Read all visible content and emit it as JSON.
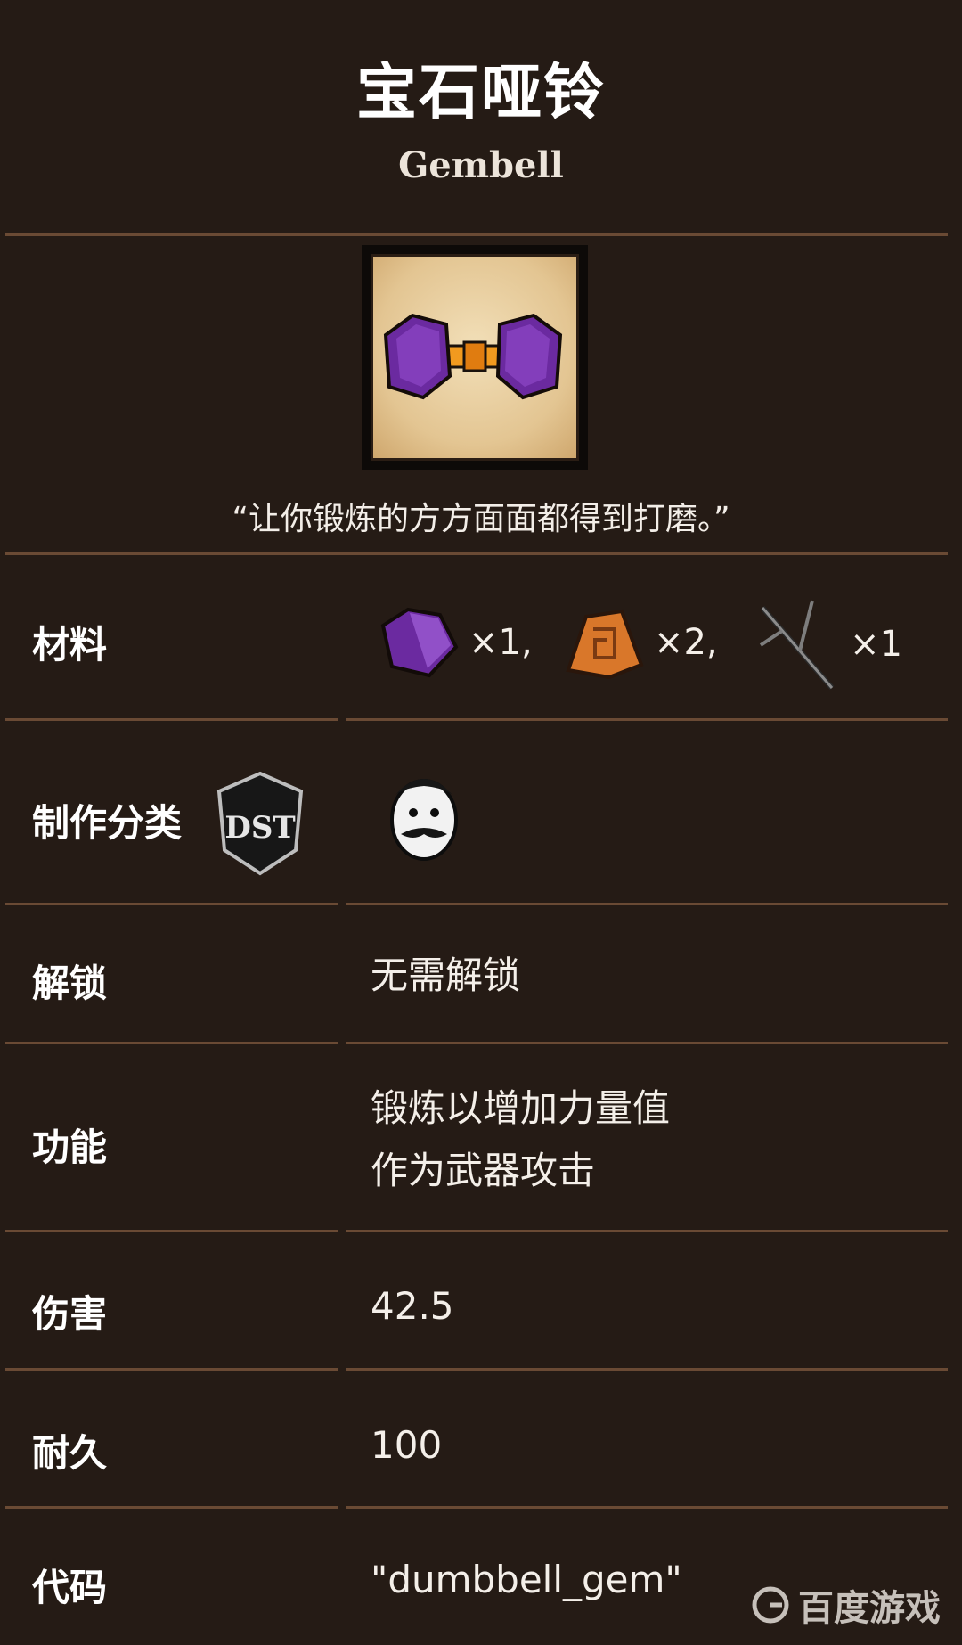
{
  "item": {
    "title_cn": "宝石哑铃",
    "title_en": "Gembell",
    "quote": "“让你锻炼的方方面面都得到打磨。”"
  },
  "rows": {
    "materials": {
      "label": "材料",
      "items": [
        {
          "icon": "purple-gem-icon",
          "qty": "×1,"
        },
        {
          "icon": "thulecite-icon",
          "qty": "×2,"
        },
        {
          "icon": "twigs-icon",
          "qty": "×1"
        }
      ]
    },
    "category": {
      "label": "制作分类",
      "badge_icon": "dst-badge-icon",
      "value_icon": "wolfgang-portrait-icon"
    },
    "unlock": {
      "label": "解锁",
      "value": "无需解锁"
    },
    "function": {
      "label": "功能",
      "line1": "锻炼以增加力量值",
      "line2": "作为武器攻击"
    },
    "damage": {
      "label": "伤害",
      "value": "42.5"
    },
    "durability": {
      "label": "耐久",
      "value": "100"
    },
    "code": {
      "label": "代码",
      "value": "\"dumbbell_gem\""
    }
  },
  "watermark": {
    "text": "百度游戏",
    "icon": "baidu-games-logo-icon"
  },
  "colors": {
    "background": "#251b15",
    "divider": "#6a4a34",
    "gem_purple": "#6b2aa0",
    "handle_orange": "#f29a1f"
  }
}
